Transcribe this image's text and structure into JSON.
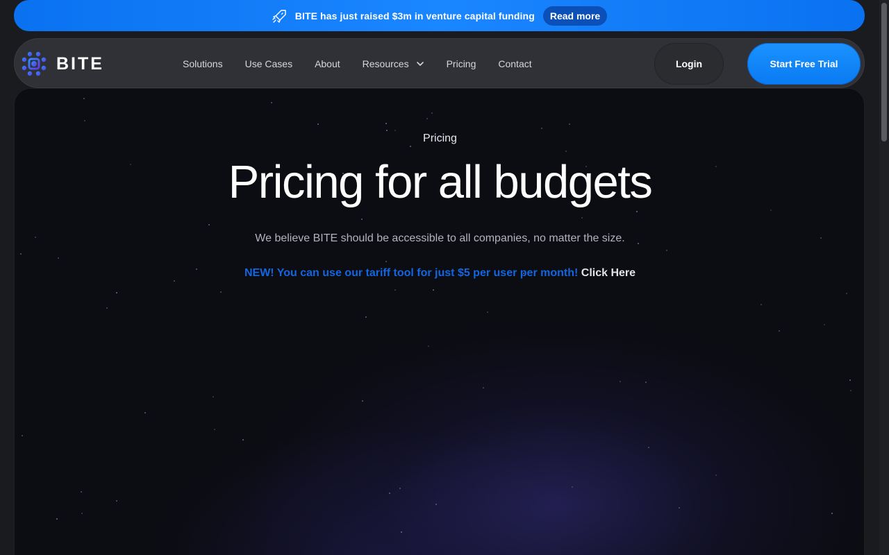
{
  "announcement": {
    "icon": "rocket-icon",
    "message": "BITE has just raised $3m in venture capital funding",
    "cta": "Read more",
    "color": "#1a86ff"
  },
  "nav": {
    "brand": "BITE",
    "menu": [
      {
        "label": "Solutions"
      },
      {
        "label": "Use Cases"
      },
      {
        "label": "About"
      },
      {
        "label": "Resources",
        "icon": "chevron-down-icon"
      },
      {
        "label": "Pricing"
      },
      {
        "label": "Contact"
      }
    ],
    "login": "Login",
    "trial": "Start Free Trial",
    "accent": "#0a7af2"
  },
  "hero": {
    "eyebrow": "Pricing",
    "title": "Pricing for all budgets",
    "subtitle": "We believe BITE should be accessible to all companies, no matter the size.",
    "promo": "NEW! You can use our tariff tool for just $5 per user per month!",
    "promo_link": "Click Here",
    "promo_color": "#1266e0"
  }
}
